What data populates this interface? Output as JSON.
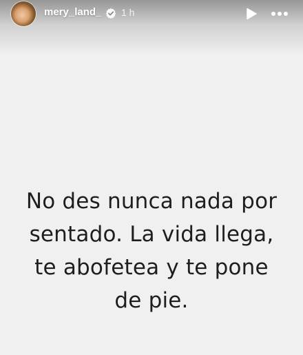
{
  "header": {
    "username": "mery_land_",
    "time": "1 h",
    "avatar_icon": "profile-avatar",
    "verified_icon": "verified-badge",
    "play_icon": "play",
    "more_icon": "more-dots"
  },
  "story": {
    "background_color": "#f0f0f0",
    "text_color": "#1e1e1e",
    "lines": [
      "No des nunca nada por",
      "sentado. La vida llega,",
      "te abofetea y te pone",
      "de pie."
    ]
  }
}
